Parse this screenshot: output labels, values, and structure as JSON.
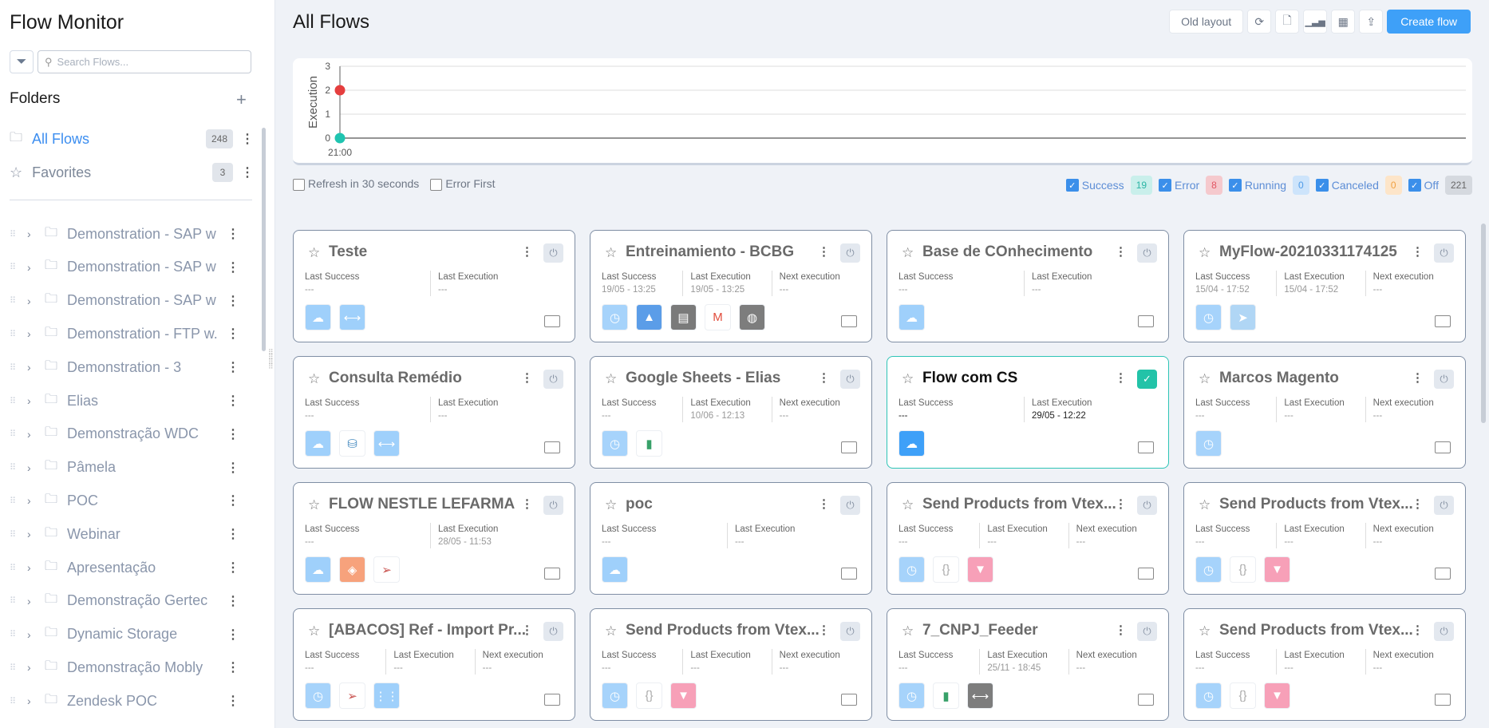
{
  "sidebar": {
    "title": "Flow Monitor",
    "search_placeholder": "Search Flows...",
    "folders_heading": "Folders",
    "all_flows": {
      "label": "All Flows",
      "count": "248"
    },
    "favorites": {
      "label": "Favorites",
      "count": "3"
    },
    "folders": [
      "Demonstration - SAP w",
      "Demonstration - SAP w",
      "Demonstration - SAP w",
      "Demonstration - FTP w.",
      "Demonstration - 3",
      "Elias",
      "Demonstração WDC",
      "Pâmela",
      "POC",
      "Webinar",
      "Apresentação",
      "Demonstração Gertec",
      "Dynamic Storage",
      "Demonstração Mobly",
      "Zendesk POC"
    ]
  },
  "header": {
    "title": "All Flows",
    "old_layout": "Old layout",
    "create": "Create flow"
  },
  "chart_data": {
    "type": "scatter",
    "ylabel": "Execution",
    "x": [
      "21:00"
    ],
    "yticks": [
      0,
      1,
      2,
      3
    ],
    "ylim": [
      0,
      3
    ],
    "series": [
      {
        "name": "Error",
        "color": "#e53e3e",
        "values": [
          2
        ]
      },
      {
        "name": "Success",
        "color": "#1fc4b0",
        "values": [
          0
        ]
      }
    ]
  },
  "options": {
    "refresh": "Refresh in 30 seconds",
    "error_first": "Error First"
  },
  "status_filters": [
    {
      "label": "Success",
      "count": "19",
      "bg": "#c9efeb",
      "fg": "#2bb5a5"
    },
    {
      "label": "Error",
      "count": "8",
      "bg": "#f5c9cd",
      "fg": "#e25563"
    },
    {
      "label": "Running",
      "count": "0",
      "bg": "#cde4fb",
      "fg": "#4e9be8"
    },
    {
      "label": "Canceled",
      "count": "0",
      "bg": "#fde5c9",
      "fg": "#f0a040"
    },
    {
      "label": "Off",
      "count": "221",
      "bg": "#d5d9df",
      "fg": "#666"
    }
  ],
  "labels": {
    "last_success": "Last Success",
    "last_execution": "Last Execution",
    "next_execution": "Next execution"
  },
  "flows": [
    {
      "name": "Teste",
      "ls": "---",
      "le": "---",
      "ne": null,
      "active": false,
      "apps": [
        "cloud",
        "api"
      ]
    },
    {
      "name": "Entreinamiento - BCBG",
      "ls": "19/05 - 13:25",
      "le": "19/05 - 13:25",
      "ne": "---",
      "active": false,
      "apps": [
        "clock",
        "azure",
        "csv",
        "gmail",
        "web"
      ]
    },
    {
      "name": "Base de COnhecimento",
      "ls": "---",
      "le": "---",
      "ne": null,
      "active": false,
      "apps": [
        "cloud"
      ]
    },
    {
      "name": "MyFlow-20210331174125",
      "ls": "15/04 - 17:52",
      "le": "15/04 - 17:52",
      "ne": "---",
      "active": false,
      "apps": [
        "clock",
        "telegram"
      ]
    },
    {
      "name": "Consulta Remédio",
      "ls": "---",
      "le": "---",
      "ne": null,
      "active": false,
      "apps": [
        "cloud",
        "mysql",
        "api"
      ]
    },
    {
      "name": "Google Sheets - Elias",
      "ls": "---",
      "le": "10/06 - 12:13",
      "ne": "---",
      "active": false,
      "apps": [
        "clock",
        "sheets"
      ]
    },
    {
      "name": "Flow com CS",
      "ls": "---",
      "le": "29/05 - 12:22",
      "ne": null,
      "active": true,
      "apps": [
        "cloud-on"
      ]
    },
    {
      "name": "Marcos Magento",
      "ls": "---",
      "le": "---",
      "ne": "---",
      "active": false,
      "apps": [
        "clock"
      ]
    },
    {
      "name": "FLOW NESTLE LEFARMA",
      "ls": "---",
      "le": "28/05 - 11:53",
      "ne": null,
      "active": false,
      "apps": [
        "cloud",
        "magento",
        "sqlserver"
      ]
    },
    {
      "name": "poc",
      "ls": "---",
      "le": "---",
      "ne": null,
      "active": false,
      "apps": [
        "cloud"
      ]
    },
    {
      "name": "Send Products from Vtex...",
      "ls": "---",
      "le": "---",
      "ne": "---",
      "active": false,
      "apps": [
        "clock",
        "json",
        "vtex"
      ]
    },
    {
      "name": "Send Products from Vtex...",
      "ls": "---",
      "le": "---",
      "ne": "---",
      "active": false,
      "apps": [
        "clock",
        "json",
        "vtex"
      ]
    },
    {
      "name": "[ABACOS] Ref - Import Pr...",
      "ls": "---",
      "le": "---",
      "ne": "---",
      "active": false,
      "apps": [
        "clock",
        "sqlserver",
        "mapper"
      ]
    },
    {
      "name": "Send Products from Vtex...",
      "ls": "---",
      "le": "---",
      "ne": "---",
      "active": false,
      "apps": [
        "clock",
        "json",
        "vtex"
      ]
    },
    {
      "name": "7_CNPJ_Feeder",
      "ls": "---",
      "le": "25/11 - 18:45",
      "ne": "---",
      "active": false,
      "apps": [
        "clock",
        "sheets",
        "api-gray"
      ]
    },
    {
      "name": "Send Products from Vtex...",
      "ls": "---",
      "le": "---",
      "ne": "---",
      "active": false,
      "apps": [
        "clock",
        "json",
        "vtex"
      ]
    }
  ]
}
